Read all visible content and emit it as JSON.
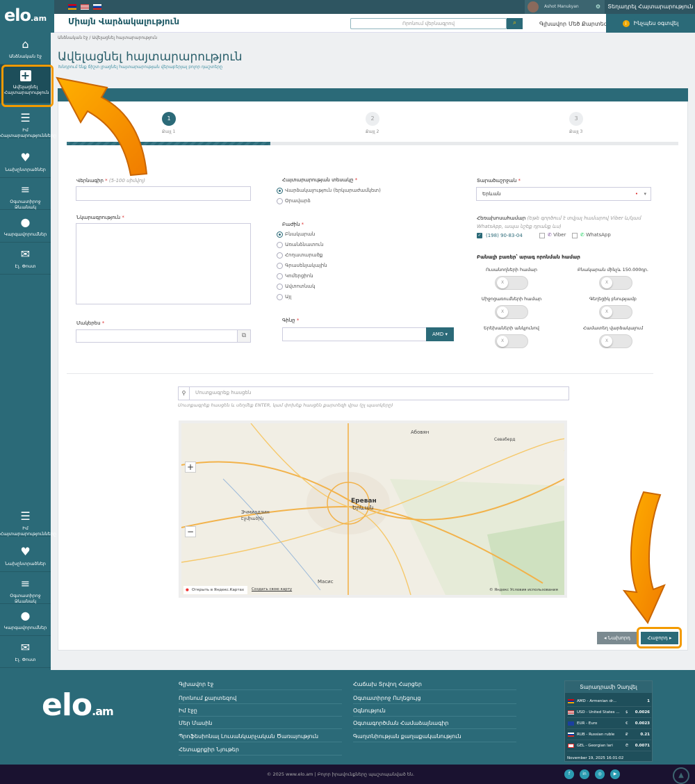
{
  "topbar": {
    "user_name": "Ashot Manukyan",
    "login_label": "Տեղադրել Հայտարարություն"
  },
  "header": {
    "logo": "elo",
    "logo_suffix": ".am",
    "site_title": "Միայն Վարձակալություն",
    "search_placeholder": "Որոնում վերնագրով",
    "nav_main": "Գլխավոր",
    "nav_catalog": "Մեծ Քարտեզ",
    "help_label": "Ինչպես օգտվել"
  },
  "sidebar": {
    "items": [
      {
        "label": "Անձնական էջ",
        "icon": "home-icon"
      },
      {
        "label": "Ավելացնել Հայտարարություն",
        "icon": "plus-square-icon"
      },
      {
        "label": "Իմ Հայտարարությունները",
        "icon": "list-icon"
      },
      {
        "label": "Նախընտրածներ",
        "icon": "heart-icon"
      },
      {
        "label": "Օգտատիրոջ Ձևանակ",
        "icon": "layers-icon"
      },
      {
        "label": "Կարգավորումներ",
        "icon": "user-icon"
      },
      {
        "label": "Էլ. Փոստ",
        "icon": "envelope-icon"
      }
    ]
  },
  "breadcrumb": {
    "home": "Անձնական էջ",
    "current": "Ավելացնել հայտարարություն"
  },
  "page": {
    "title": "Ավելացնել հայտարարություն",
    "subtitle": "Խնդրում ենք ճիշտ լրացնել հայտարարության վերաբերյալ բոլոր դաշտերը"
  },
  "steps": [
    {
      "num": "1",
      "label": "Քայլ 1"
    },
    {
      "num": "2",
      "label": "Քայլ 2"
    },
    {
      "num": "3",
      "label": "Քայլ 3"
    }
  ],
  "progress": 0.33,
  "form": {
    "title_label": "Վերնագիր",
    "title_hint": "(5-100 սիմվոլ)",
    "desc_label": "Նկարագրություն",
    "slug_label": "Մակերես",
    "type_label": "Հայտարարության տեսակը",
    "type_options": [
      {
        "label": "Վարձակալություն (երկարաժամկետ)",
        "on": true
      },
      {
        "label": "Օրավարձ",
        "on": false
      }
    ],
    "section_label": "Բաժին",
    "section_options": [
      {
        "label": "Բնակարան",
        "on": true
      },
      {
        "label": "Առանձնատուն",
        "on": false
      },
      {
        "label": "Հողատարածք",
        "on": false
      },
      {
        "label": "Գրասենյակային",
        "on": false
      },
      {
        "label": "Կոմերցիոն",
        "on": false
      },
      {
        "label": "Ավտոտնակ",
        "on": false
      },
      {
        "label": "Այլ",
        "on": false
      }
    ],
    "price_label": "Գինը",
    "currency": "AMD",
    "region_label": "Տարածաշրջան",
    "region_value": "Երևան",
    "phone_label": "Հեռախոսահամար",
    "phone_hint": "(Եթե գործում է տվյալ համարով Viber և/կամ WhatsApp, ապա նշեք դրանք ևս)",
    "phone_value": "(198) 90-83-04",
    "viber": "Viber",
    "whatsapp": "WhatsApp",
    "extras_label": "Բանալի բառեր՝ արագ որոնման համար",
    "toggles": [
      {
        "label": "Ուսանողների համար"
      },
      {
        "label": "Բնակարան մինչև 150.000դր."
      },
      {
        "label": "Միջոցառումների համար"
      },
      {
        "label": "Գեղեցիկ բնությամբ"
      },
      {
        "label": "Երեխաների անկյունով"
      },
      {
        "label": "Համատեղ վարձակալում"
      }
    ],
    "address_placeholder": "Մուտքագրեք հասցեն",
    "address_hint": "Մուտքագրեք հասցեն և սեղմեք ENTER, կամ փոխեք հասցեն քարտեզի վրա (ըլ պատկերը)"
  },
  "map": {
    "yandex_link": "Открыть в Яндекс.Картах",
    "create_link": "Создать свою карту",
    "copyright": "© Яндекс Условия использования"
  },
  "buttons": {
    "prev": "Նախորդ",
    "next": "Հաջորդ"
  },
  "footer": {
    "col1": [
      "Գլխավոր էջ",
      "Որոնում քարտեզով",
      "Իմ էջը",
      "Մեր Մասին",
      "Պրոֆեսիոնալ Լուսանկարչական Ծառայություն",
      "Հետաքրքիր Նյութեր"
    ],
    "col2": [
      "Հաճախ Տրվող Հարցեր",
      "Օգտատիրոջ Ուղեցույց",
      "Օգնություն",
      "Օգտագործման Համաձայնագիր",
      "Գաղտնիության քաղաքականություն"
    ],
    "rates_title": "Տարադրամի Չաղվել",
    "rates": [
      {
        "name": "AMD - Armenian dr...",
        "sym": "",
        "val": "1",
        "flag": "#d22"
      },
      {
        "name": "USD - United States ...",
        "sym": "$",
        "val": "0.0026",
        "flag": "#335"
      },
      {
        "name": "EUR - Euro",
        "sym": "€",
        "val": "0.0023",
        "flag": "#1a3fa0"
      },
      {
        "name": "RUB - Russian ruble",
        "sym": "₽",
        "val": "0.21",
        "flag": "#fff"
      },
      {
        "name": "GEL - Georgian lari",
        "sym": "₾",
        "val": "0.0071",
        "flag": "#eee"
      }
    ],
    "rates_date": "November 19, 2025 16:01:02",
    "copyright": "© 2025 www.elo.am | Բոլոր իրավունքները պաշտպանված են."
  },
  "colors": {
    "primary": "#2b6a78",
    "accent": "#f39a00"
  }
}
